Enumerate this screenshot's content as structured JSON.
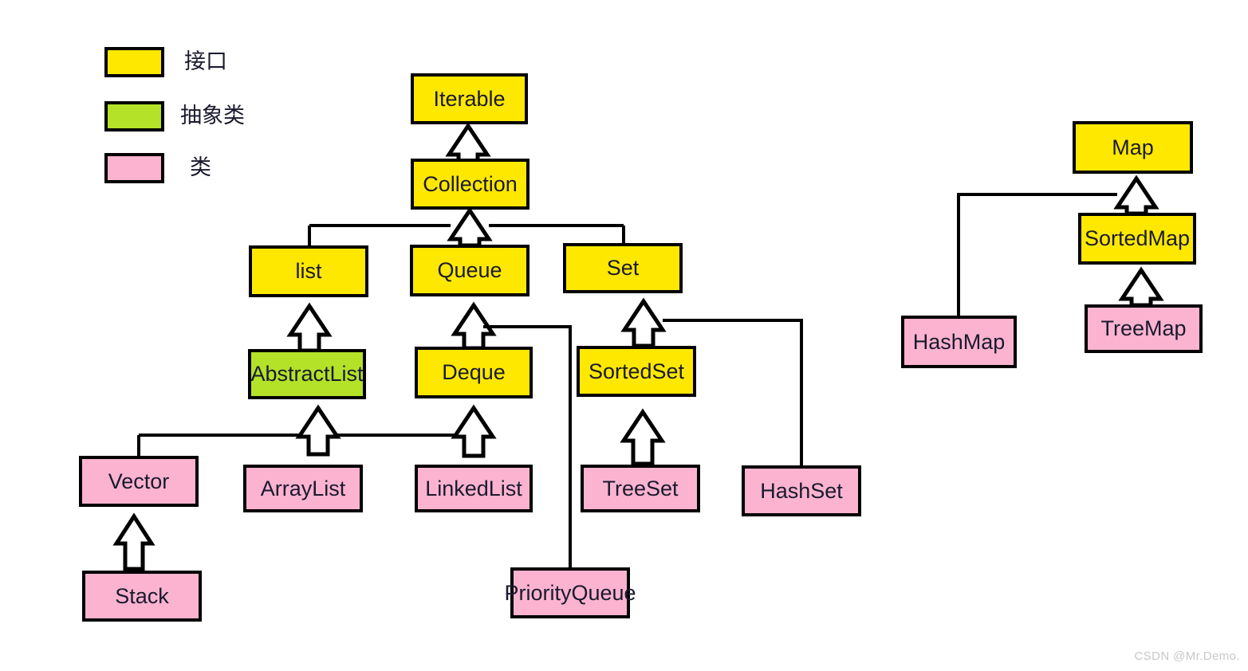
{
  "legend": {
    "items": [
      {
        "label": "接口",
        "kind": "interface",
        "color": "#ffe800"
      },
      {
        "label": "抽象类",
        "kind": "abstract-class",
        "color": "#b3e228"
      },
      {
        "label": "类",
        "kind": "class",
        "color": "#fbb3cf"
      }
    ]
  },
  "nodes": {
    "iterable": "Iterable",
    "collection": "Collection",
    "list": "list",
    "queue": "Queue",
    "set": "Set",
    "abstractlist": "AbstractList",
    "deque": "Deque",
    "sortedset": "SortedSet",
    "vector": "Vector",
    "arraylist": "ArrayList",
    "linkedlist": "LinkedList",
    "treeset": "TreeSet",
    "hashset": "HashSet",
    "stack": "Stack",
    "priorityqueue": "PriorityQueue",
    "map": "Map",
    "sortedmap": "SortedMap",
    "hashmap": "HashMap",
    "treemap": "TreeMap"
  },
  "relations": [
    {
      "from": "Collection",
      "to": "Iterable"
    },
    {
      "from": "list",
      "to": "Collection"
    },
    {
      "from": "Queue",
      "to": "Collection"
    },
    {
      "from": "Set",
      "to": "Collection"
    },
    {
      "from": "AbstractList",
      "to": "list"
    },
    {
      "from": "Deque",
      "to": "Queue"
    },
    {
      "from": "PriorityQueue",
      "to": "Queue"
    },
    {
      "from": "SortedSet",
      "to": "Set"
    },
    {
      "from": "HashSet",
      "to": "Set"
    },
    {
      "from": "Vector",
      "to": "AbstractList"
    },
    {
      "from": "ArrayList",
      "to": "AbstractList"
    },
    {
      "from": "LinkedList",
      "to": "Deque"
    },
    {
      "from": "Stack",
      "to": "Vector"
    },
    {
      "from": "TreeSet",
      "to": "SortedSet"
    },
    {
      "from": "SortedMap",
      "to": "Map"
    },
    {
      "from": "HashMap",
      "to": "Map"
    },
    {
      "from": "TreeMap",
      "to": "SortedMap"
    }
  ],
  "watermark": "CSDN @Mr.Demo."
}
